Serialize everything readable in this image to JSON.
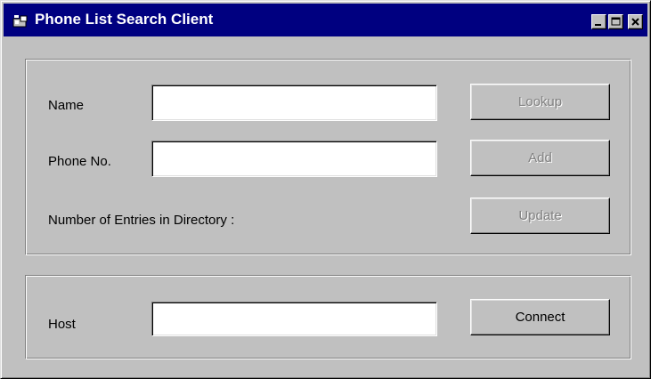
{
  "window": {
    "title": "Phone List Search Client",
    "controls": {
      "minimize": "minimize-icon",
      "maximize": "maximize-icon",
      "close": "close-icon"
    }
  },
  "directory": {
    "name_label": "Name",
    "name_value": "",
    "phone_label": "Phone No.",
    "phone_value": "",
    "entries_label": "Number of Entries in Directory :",
    "lookup_label": "Lookup",
    "add_label": "Add",
    "update_label": "Update"
  },
  "connection": {
    "host_label": "Host",
    "host_value": "",
    "connect_label": "Connect"
  },
  "colors": {
    "titlebar": "#000080",
    "face": "#c0c0c0",
    "disabled_text": "#808080"
  }
}
